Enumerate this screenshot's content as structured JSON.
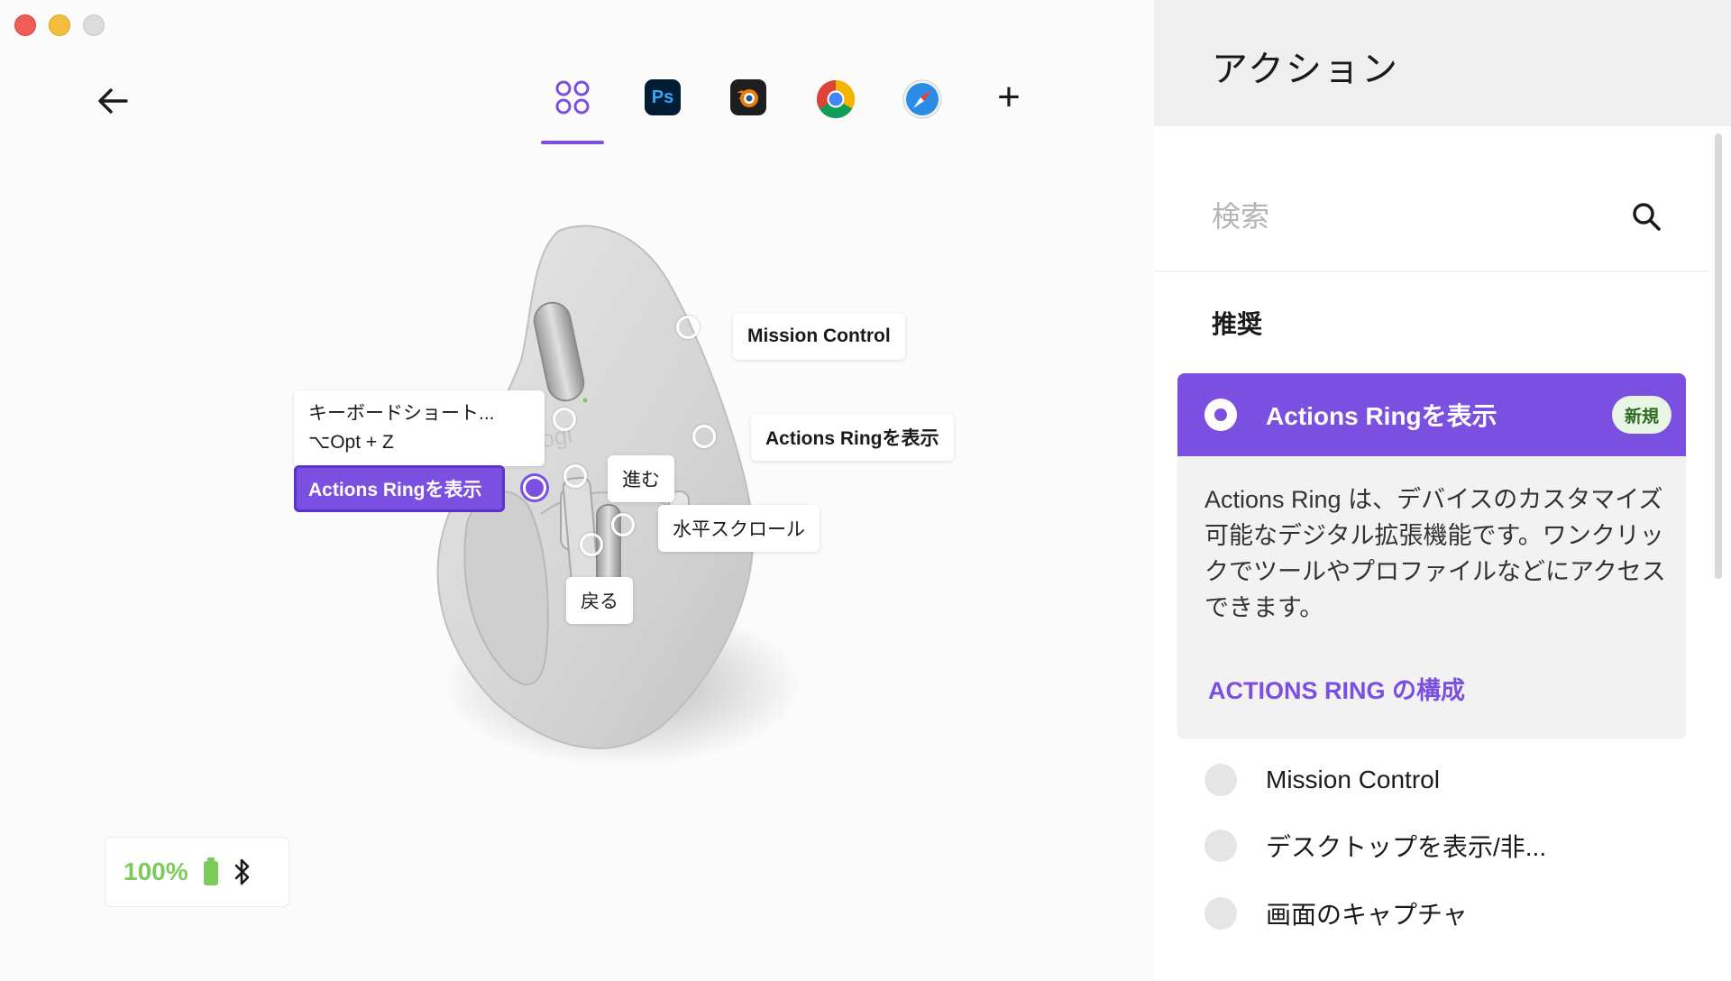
{
  "header": {
    "app_tabs": [
      {
        "name": "all-apps",
        "icon": "grid-icon",
        "active": true
      },
      {
        "name": "photoshop",
        "label": "Ps"
      },
      {
        "name": "blender",
        "icon": "blender-icon"
      },
      {
        "name": "chrome",
        "icon": "chrome-icon"
      },
      {
        "name": "safari",
        "icon": "safari-icon"
      }
    ],
    "add_symbol": "+"
  },
  "mouse": {
    "callouts": {
      "mission_control": "Mission Control",
      "keyboard_shortcut_line1": "キーボードショート...",
      "keyboard_shortcut_line2": "⌥Opt + Z",
      "thumb_button": "Actions Ringを表示",
      "mode_shift": "Actions Ringを表示",
      "forward": "進む",
      "horizontal_scroll": "水平スクロール",
      "back": "戻る"
    }
  },
  "status": {
    "battery": "100%",
    "connection_icon": "bluetooth-icon"
  },
  "panel": {
    "title": "アクション",
    "search_placeholder": "検索",
    "section": "推奨",
    "selected": {
      "title": "Actions Ringを表示",
      "badge": "新規",
      "description": "Actions Ring は、デバイスのカスタマイズ可能なデジタル拡張機能です。ワンクリックでツールやプロファイルなどにアクセスできます。",
      "link": "ACTIONS RING の構成"
    },
    "actions": [
      "Mission Control",
      "デスクトップを表示/非...",
      "画面のキャプチャ"
    ]
  },
  "colors": {
    "accent": "#7b4fe0",
    "battery_green": "#7ccb5c",
    "badge_bg": "#e9f6e6"
  }
}
